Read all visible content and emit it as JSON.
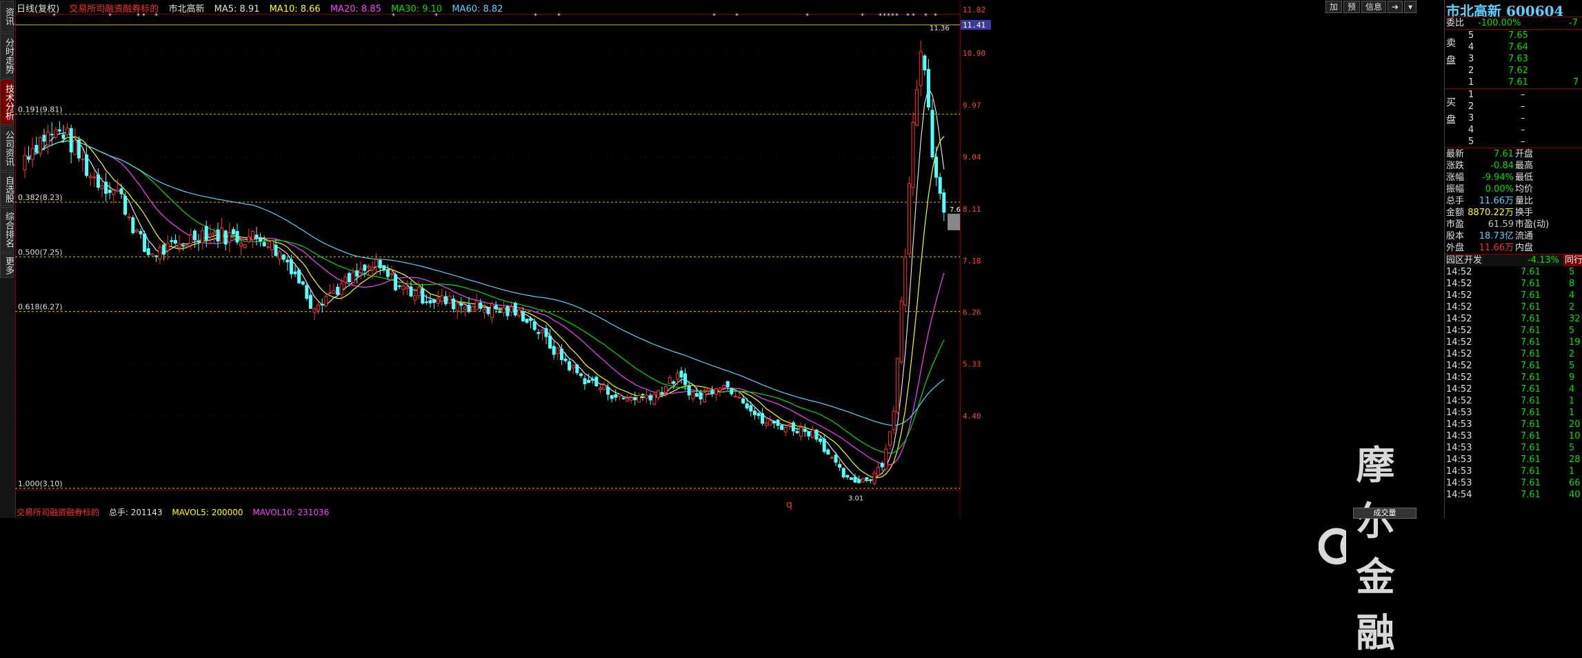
{
  "left_tabs": [
    "资讯",
    "分时走势",
    "技术分析",
    "公司资讯",
    "自选股",
    "综合排名",
    "更多"
  ],
  "header": {
    "period": "日线(复权)",
    "tag": "交易所司融资融券标的",
    "stock": "市北高新",
    "ma5": "MA5: 8.91",
    "ma10": "MA10: 8.66",
    "ma20": "MA20: 8.85",
    "ma30": "MA30: 9.10",
    "ma60": "MA60: 8.82"
  },
  "toolbar": [
    "加",
    "预",
    "信息"
  ],
  "price_axis": [
    "11.82",
    "11.41",
    "10.90",
    "9.97",
    "9.04",
    "8.11",
    "7.18",
    "6.26",
    "5.33",
    "4.40"
  ],
  "current_price_label": "7.6",
  "high_label": "11.36",
  "low_label": "3.01",
  "fib_levels": [
    {
      "label": "0.191(9.81)",
      "price": 9.81
    },
    {
      "label": "0.382(8.23)",
      "price": 8.23
    },
    {
      "label": "0.500(7.25)",
      "price": 7.25
    },
    {
      "label": "0.618(6.27)",
      "price": 6.27
    },
    {
      "label": "1.000(3.10)",
      "price": 3.1
    }
  ],
  "bottom": {
    "text1": "交易所司融资融券标的",
    "text2": "总手: 201143",
    "text3": "MAVOL5: 200000",
    "text4": "MAVOL10: 231036",
    "tab": "成交量",
    "marker": "q"
  },
  "watermark": "摩尔金融",
  "quote_panel": {
    "title": "市北高新 600604",
    "weibi_label": "委比",
    "weibi_value": "-100.00%",
    "weibi_right": "-7",
    "sell_label": "卖盘",
    "buy_label": "买盘",
    "sell": [
      {
        "n": "5",
        "price": "7.65"
      },
      {
        "n": "4",
        "price": "7.64"
      },
      {
        "n": "3",
        "price": "7.63"
      },
      {
        "n": "2",
        "price": "7.62"
      },
      {
        "n": "1",
        "price": "7.61",
        "vol": "7"
      }
    ],
    "buy": [
      {
        "n": "1",
        "price": "–"
      },
      {
        "n": "2",
        "price": "–"
      },
      {
        "n": "3",
        "price": "–"
      },
      {
        "n": "4",
        "price": "–"
      },
      {
        "n": "5",
        "price": "–"
      }
    ],
    "stats": [
      {
        "l": "最新",
        "v": "7.61",
        "l2": "开盘"
      },
      {
        "l": "涨跌",
        "v": "-0.84",
        "l2": "最高"
      },
      {
        "l": "涨幅",
        "v": "-9.94%",
        "l2": "最低"
      },
      {
        "l": "振幅",
        "v": "0.00%",
        "l2": "均价"
      },
      {
        "l": "总手",
        "v": "11.66万",
        "l2": "量比"
      },
      {
        "l": "金额",
        "v": "8870.22万",
        "l2": "换手"
      },
      {
        "l": "市盈",
        "v": "61.59",
        "l2": "市盈(动)"
      },
      {
        "l": "股本",
        "v": "18.73亿",
        "l2": "流通"
      },
      {
        "l": "外盘",
        "v": "11.66万",
        "l2": "内盘"
      }
    ],
    "sector": {
      "name": "园区开发",
      "change": "-4.13%",
      "tab": "同行"
    },
    "ticks": [
      {
        "t": "14:52",
        "p": "7.61",
        "v": "5"
      },
      {
        "t": "14:52",
        "p": "7.61",
        "v": "8"
      },
      {
        "t": "14:52",
        "p": "7.61",
        "v": "4"
      },
      {
        "t": "14:52",
        "p": "7.61",
        "v": "2"
      },
      {
        "t": "14:52",
        "p": "7.61",
        "v": "32"
      },
      {
        "t": "14:52",
        "p": "7.61",
        "v": "5"
      },
      {
        "t": "14:52",
        "p": "7.61",
        "v": "19"
      },
      {
        "t": "14:52",
        "p": "7.61",
        "v": "2"
      },
      {
        "t": "14:52",
        "p": "7.61",
        "v": "5"
      },
      {
        "t": "14:52",
        "p": "7.61",
        "v": "9"
      },
      {
        "t": "14:52",
        "p": "7.61",
        "v": "4"
      },
      {
        "t": "14:52",
        "p": "7.61",
        "v": "1"
      },
      {
        "t": "14:53",
        "p": "7.61",
        "v": "1"
      },
      {
        "t": "14:53",
        "p": "7.61",
        "v": "20"
      },
      {
        "t": "14:53",
        "p": "7.61",
        "v": "10"
      },
      {
        "t": "14:53",
        "p": "7.61",
        "v": "5"
      },
      {
        "t": "14:53",
        "p": "7.61",
        "v": "28"
      },
      {
        "t": "14:53",
        "p": "7.61",
        "v": "1"
      },
      {
        "t": "14:53",
        "p": "7.61",
        "v": "66"
      },
      {
        "t": "14:54",
        "p": "7.61",
        "v": "40"
      }
    ]
  }
}
